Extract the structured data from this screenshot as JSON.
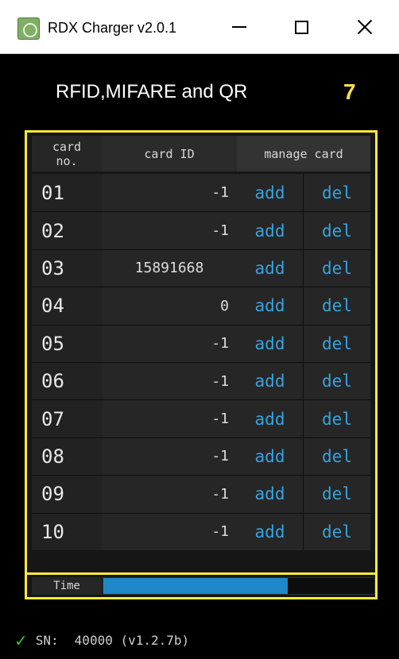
{
  "window": {
    "title": "RDX Charger v2.0.1"
  },
  "header": {
    "title": "RFID,MIFARE and QR",
    "count": "7",
    "count_color": "#ffe14a"
  },
  "table": {
    "col_no": "card\nno.",
    "col_id": "card ID",
    "col_manage": "manage card",
    "rows": [
      {
        "no": "01",
        "id": "-1",
        "add": "add",
        "del": "del"
      },
      {
        "no": "02",
        "id": "-1",
        "add": "add",
        "del": "del"
      },
      {
        "no": "03",
        "id": "15891668",
        "add": "add",
        "del": "del"
      },
      {
        "no": "04",
        "id": "0",
        "add": "add",
        "del": "del"
      },
      {
        "no": "05",
        "id": "-1",
        "add": "add",
        "del": "del"
      },
      {
        "no": "06",
        "id": "-1",
        "add": "add",
        "del": "del"
      },
      {
        "no": "07",
        "id": "-1",
        "add": "add",
        "del": "del"
      },
      {
        "no": "08",
        "id": "-1",
        "add": "add",
        "del": "del"
      },
      {
        "no": "09",
        "id": "-1",
        "add": "add",
        "del": "del"
      },
      {
        "no": "10",
        "id": "-1",
        "add": "add",
        "del": "del"
      }
    ]
  },
  "time": {
    "label": "Time",
    "progress": 0.68,
    "bar_color": "#1f88c8"
  },
  "footer": {
    "sn_label": "SN:",
    "sn_value": "40000 (v1.2.7b)",
    "status_icon": "check-icon",
    "status_color": "#22cc33"
  },
  "colors": {
    "accent_border": "#ffeb3b",
    "link": "#36a3df",
    "background": "#000000"
  }
}
